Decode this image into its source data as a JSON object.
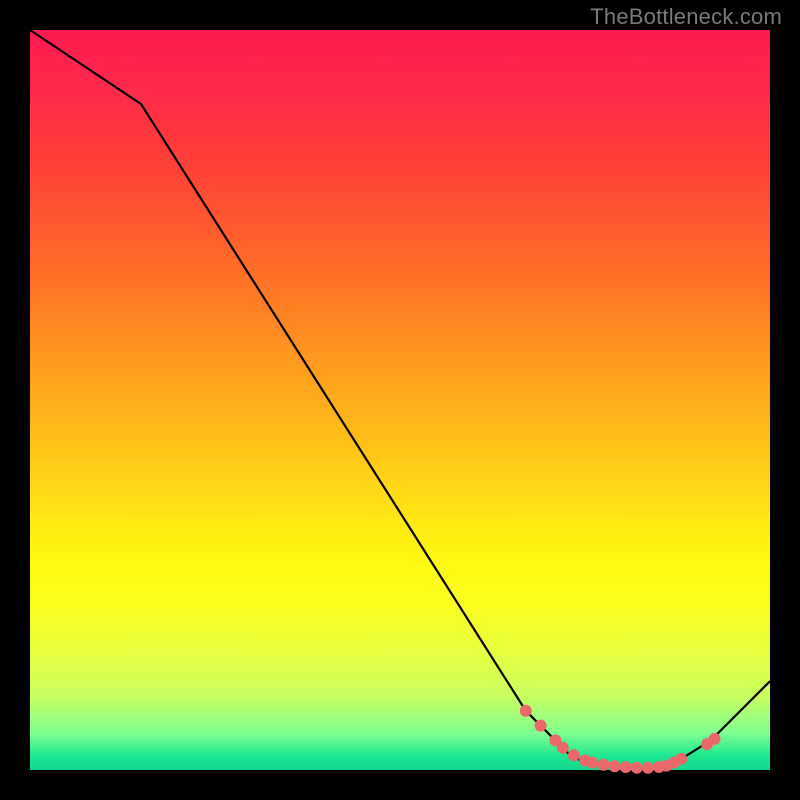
{
  "watermark": "TheBottleneck.com",
  "colors": {
    "background": "#000000",
    "line": "#000000",
    "marker": "#e9696a",
    "gradient_top": "#ff1a51",
    "gradient_bottom": "#10d890"
  },
  "chart_data": {
    "type": "line",
    "title": "",
    "xlabel": "",
    "ylabel": "",
    "xlim": [
      0,
      100
    ],
    "ylim": [
      0,
      100
    ],
    "grid": false,
    "legend": false,
    "x": [
      0,
      15,
      67,
      72,
      73,
      74,
      75,
      77,
      79,
      81,
      83,
      85,
      86,
      87,
      88,
      92,
      100
    ],
    "y": [
      100,
      90,
      8,
      3,
      2,
      1.5,
      1,
      0.6,
      0.4,
      0.3,
      0.3,
      0.4,
      0.6,
      1,
      1.5,
      4,
      12
    ],
    "markers": {
      "x": [
        67,
        69,
        71,
        72,
        73.5,
        75,
        76,
        77.5,
        79,
        80.5,
        82,
        83.5,
        85,
        86,
        87,
        88,
        91.5,
        92.5
      ],
      "y": [
        8,
        6,
        4,
        3,
        2,
        1.3,
        1,
        0.7,
        0.5,
        0.4,
        0.3,
        0.3,
        0.4,
        0.6,
        1,
        1.5,
        3.5,
        4.2
      ]
    }
  }
}
